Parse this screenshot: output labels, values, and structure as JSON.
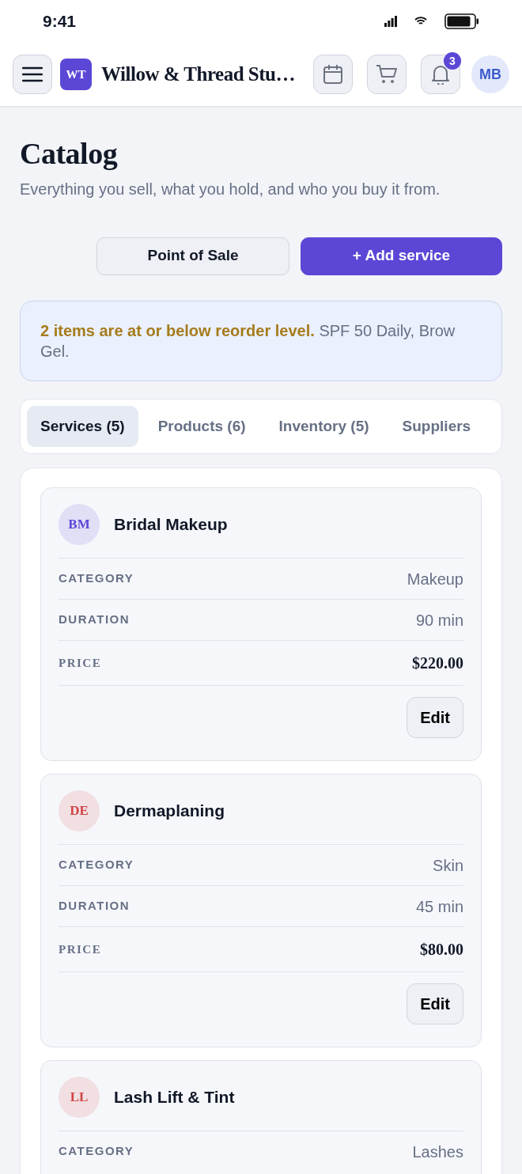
{
  "status_bar": {
    "time": "9:41"
  },
  "header": {
    "logo": "WT",
    "title": "Willow & Thread Stu…",
    "notifications": "3",
    "avatar": "MB"
  },
  "page": {
    "title": "Catalog",
    "subtitle": "Everything you sell, what you hold, and who you buy it from."
  },
  "actions": [
    {
      "label": "Point of Sale",
      "kind": "secondary"
    },
    {
      "label": "+ Add service",
      "kind": "primary"
    }
  ],
  "alert": {
    "text": "**2 items are at or below reorder level.** SPF 50 Daily, Brow Gel."
  },
  "tabs": [
    {
      "label": "Services (5)",
      "selected": true
    },
    {
      "label": "Products (6)",
      "selected": false
    },
    {
      "label": "Inventory (5)",
      "selected": false
    },
    {
      "label": "Suppliers",
      "selected": false
    }
  ],
  "services": [
    {
      "initials": "BM",
      "color": "#5b47d6",
      "name": "Bridal Makeup",
      "fields": [
        {
          "label": "CATEGORY",
          "value": "Makeup",
          "kind": "plain"
        },
        {
          "label": "DURATION",
          "value": "90 min",
          "kind": "plain"
        },
        {
          "label": "PRICE",
          "value": "$220.00",
          "kind": "price"
        }
      ],
      "action": "Edit"
    },
    {
      "initials": "DE",
      "color": "#d04545",
      "name": "Dermaplaning",
      "fields": [
        {
          "label": "CATEGORY",
          "value": "Skin",
          "kind": "plain"
        },
        {
          "label": "DURATION",
          "value": "45 min",
          "kind": "plain"
        },
        {
          "label": "PRICE",
          "value": "$80.00",
          "kind": "price"
        }
      ],
      "action": "Edit"
    },
    {
      "initials": "LL",
      "color": "#d04545",
      "name": "Lash Lift & Tint",
      "fields": [
        {
          "label": "CATEGORY",
          "value": "Lashes",
          "kind": "plain"
        }
      ]
    }
  ]
}
